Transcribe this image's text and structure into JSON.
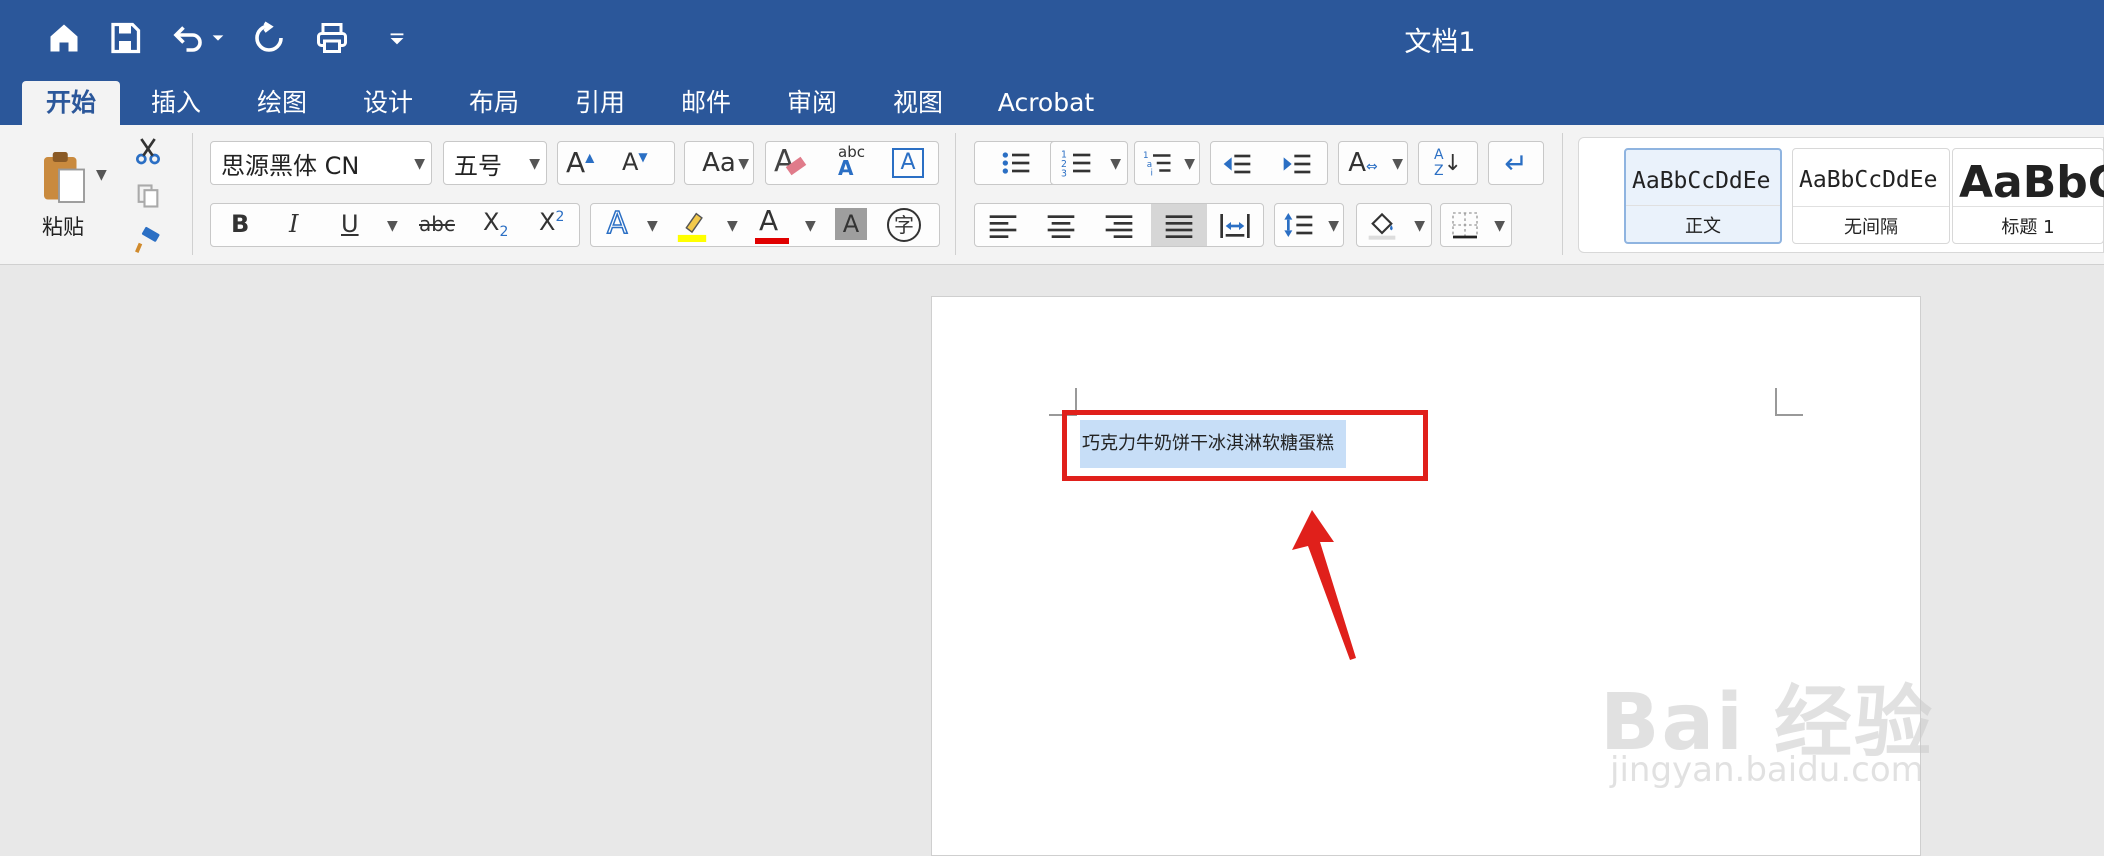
{
  "title_bar": {
    "document_title": "文档1"
  },
  "tabs": [
    {
      "label": "开始",
      "active": true
    },
    {
      "label": "插入"
    },
    {
      "label": "绘图"
    },
    {
      "label": "设计"
    },
    {
      "label": "布局"
    },
    {
      "label": "引用"
    },
    {
      "label": "邮件"
    },
    {
      "label": "审阅"
    },
    {
      "label": "视图"
    },
    {
      "label": "Acrobat"
    }
  ],
  "clipboard": {
    "paste_label": "粘贴"
  },
  "font": {
    "family": "思源黑体 CN",
    "size": "五号"
  },
  "styles": [
    {
      "preview": "AaBbCcDdEe",
      "name": "正文",
      "selected": true
    },
    {
      "preview": "AaBbCcDdEe",
      "name": "无间隔"
    },
    {
      "preview": "AaBbC",
      "name": "标题 1"
    }
  ],
  "document": {
    "selected_text": "巧克力牛奶饼干冰淇淋软糖蛋糕"
  },
  "watermark": {
    "main": "Bai 经验",
    "sub": "jingyan.baidu.com"
  },
  "colors": {
    "ribbon_blue": "#2b579a",
    "highlight_red": "#e0201b",
    "selection": "#c7def7"
  }
}
